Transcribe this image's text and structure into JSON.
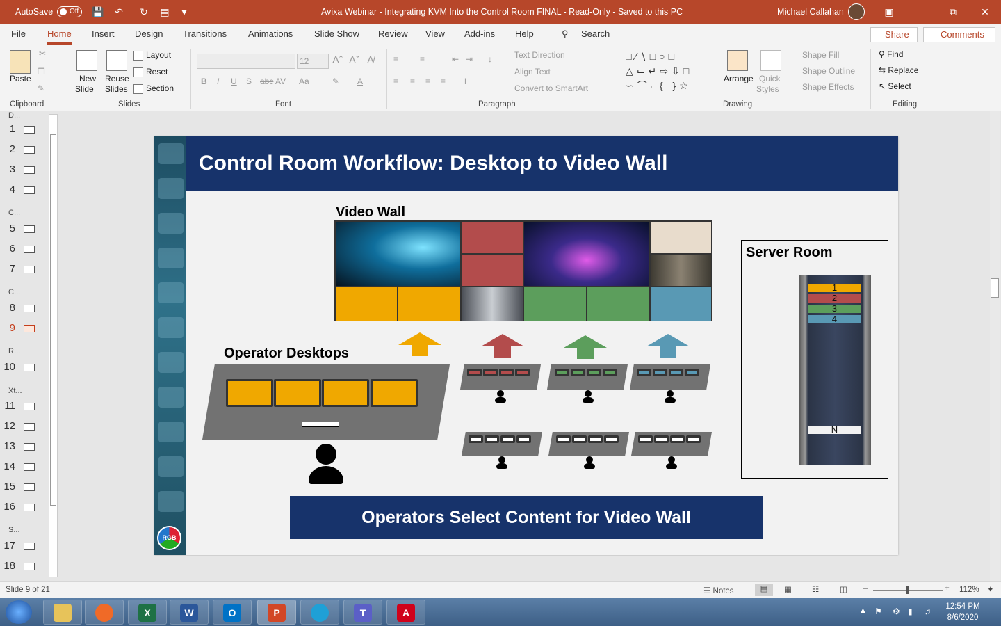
{
  "titlebar": {
    "autosave_label": "AutoSave",
    "autosave_state": "Off",
    "document_title": "Avixa Webinar - Integrating KVM Into the Control Room FINAL  -  Read-Only  -  Saved to this PC",
    "user_name": "Michael Callahan"
  },
  "menu": {
    "tabs": [
      "File",
      "Home",
      "Insert",
      "Design",
      "Transitions",
      "Animations",
      "Slide Show",
      "Review",
      "View",
      "Add-ins",
      "Help"
    ],
    "search": "Search",
    "share": "Share",
    "comments": "Comments"
  },
  "ribbon": {
    "clipboard": {
      "paste": "Paste",
      "group": "Clipboard"
    },
    "slides": {
      "new_slide": "New",
      "new_slide2": "Slide",
      "reuse": "Reuse",
      "reuse2": "Slides",
      "layout": "Layout",
      "reset": "Reset",
      "section": "Section",
      "group": "Slides"
    },
    "font": {
      "size": "12",
      "group": "Font"
    },
    "paragraph": {
      "text_direction": "Text Direction",
      "align_text": "Align Text",
      "smartart": "Convert to SmartArt",
      "group": "Paragraph"
    },
    "drawing": {
      "arrange": "Arrange",
      "quick_styles": "Quick",
      "quick_styles2": "Styles",
      "shape_fill": "Shape Fill",
      "shape_outline": "Shape Outline",
      "shape_effects": "Shape Effects",
      "group": "Drawing"
    },
    "editing": {
      "find": "Find",
      "replace": "Replace",
      "select": "Select",
      "group": "Editing"
    }
  },
  "thumbnails": {
    "sections": [
      "D...",
      "C...",
      "C...",
      "R...",
      "Xt...",
      "S..."
    ],
    "slides": [
      "1",
      "2",
      "3",
      "4",
      "5",
      "6",
      "7",
      "8",
      "9",
      "10",
      "11",
      "12",
      "13",
      "14",
      "15",
      "16",
      "17",
      "18"
    ],
    "selected": "9"
  },
  "slide": {
    "title": "Control Room Workflow: Desktop to Video Wall",
    "video_wall_label": "Video Wall",
    "operator_label": "Operator Desktops",
    "server_label": "Server Room",
    "rack_slots": [
      "1",
      "2",
      "3",
      "4",
      "N"
    ],
    "caption": "Operators Select Content for Video Wall",
    "logo": "RGB",
    "colors": {
      "yellow": "#f0a800",
      "red": "#b34c4c",
      "green": "#5c9e5c",
      "blue": "#5999b4",
      "navy": "#17336b"
    }
  },
  "status": {
    "slide_counter": "Slide 9 of 21",
    "notes": "Notes",
    "zoom": "112%"
  },
  "taskbar": {
    "apps": [
      "File Explorer",
      "Firefox",
      "Excel",
      "Word",
      "Outlook",
      "PowerPoint",
      "Edge",
      "Teams",
      "Acrobat"
    ],
    "time": "12:54 PM",
    "date": "8/6/2020"
  }
}
